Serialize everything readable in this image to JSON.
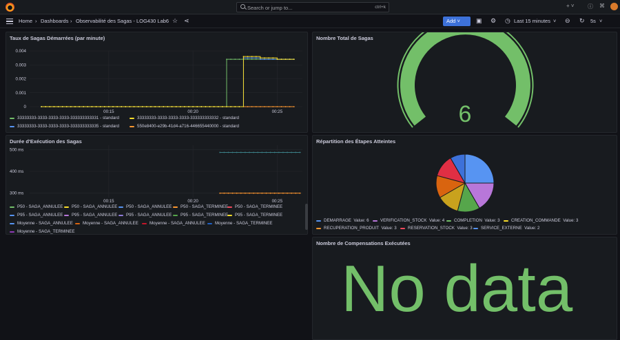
{
  "topbar": {
    "search_placeholder": "Search or jump to...",
    "search_shortcut": "ctrl+k",
    "plus_label": "+ ˅"
  },
  "navbar": {
    "home": "Home",
    "dashboards": "Dashboards",
    "dashboard_title": "Observabilité des Sagas - LOG430 Lab6",
    "add_label": "Add",
    "time_range": "Last 15 minutes",
    "refresh_interval": "5s"
  },
  "panels": {
    "rate": {
      "title": "Taux de Sagas Démarrées (par minute)",
      "legend": [
        "33333333-3333-3333-3333-333333333331 - standard",
        "33333333-3333-3333-3333-333333333332 - standard",
        "33333333-3333-3333-3333-333333333335 - standard",
        "550e8400-e29b-41d4-a716-446655440000 - standard"
      ]
    },
    "total": {
      "title": "Nombre Total de Sagas",
      "value": "6"
    },
    "duration": {
      "title": "Durée d'Exécution des Sagas",
      "legend": [
        "P50 - SAGA_ANNULEE",
        "P50 - SAGA_ANNULEE",
        "P50 - SAGA_ANNULEE",
        "P50 - SAGA_TERMINEE",
        "P50 - SAGA_TERMINEE",
        "P95 - SAGA_ANNULEE",
        "P95 - SAGA_ANNULEE",
        "P95 - SAGA_ANNULEE",
        "P95 - SAGA_TERMINEE",
        "P95 - SAGA_TERMINEE",
        "Moyenne - SAGA_ANNULEE",
        "Moyenne - SAGA_ANNULEE",
        "Moyenne - SAGA_ANNULEE",
        "Moyenne - SAGA_TERMINEE",
        "Moyenne - SAGA_TERMINEE"
      ]
    },
    "steps": {
      "title": "Répartition des Étapes Atteintes",
      "legend": [
        {
          "name": "DEMARRAGE",
          "value": "Value: 6"
        },
        {
          "name": "VERIFICATION_STOCK",
          "value": "Value: 4"
        },
        {
          "name": "COMPLETION",
          "value": "Value: 3"
        },
        {
          "name": "CREATION_COMMANDE",
          "value": "Value: 3"
        },
        {
          "name": "RECUPERATION_PRODUIT",
          "value": "Value: 3"
        },
        {
          "name": "RESERVATION_STOCK",
          "value": "Value: 3"
        },
        {
          "name": "SERVICE_EXTERNE",
          "value": "Value: 2"
        }
      ]
    },
    "compensations": {
      "title": "Nombre de Compensations Exécutées",
      "no_data": "No data"
    }
  },
  "colors": {
    "green": "#73bf69",
    "yellow": "#fade2a",
    "blue": "#5794f2",
    "orange": "#ff9830",
    "red": "#f2495c",
    "purple": "#b877d9",
    "teal": "#3b7f86",
    "dark_orange": "#d9640f",
    "olive": "#c9a21d"
  },
  "chart_data": [
    {
      "type": "line",
      "title": "Taux de Sagas Démarrées (par minute)",
      "x_ticks": [
        "00:15",
        "00:20",
        "00:25"
      ],
      "y_ticks": [
        "0",
        "0.001",
        "0.002",
        "0.003",
        "0.004"
      ],
      "ylim": [
        0,
        0.004
      ],
      "x": [
        "00:11",
        "00:12",
        "00:13",
        "00:14",
        "00:15",
        "00:16",
        "00:17",
        "00:18",
        "00:19",
        "00:20",
        "00:21",
        "00:22",
        "00:23",
        "00:24",
        "00:25",
        "00:26"
      ],
      "series": [
        {
          "name": "33333333-3333-3333-3333-333333333331 - standard",
          "values": [
            0,
            0,
            0,
            0,
            0,
            0,
            0,
            0,
            0,
            0,
            0,
            0.0034,
            0.0034,
            0.0034,
            0.0034,
            0.0034
          ]
        },
        {
          "name": "33333333-3333-3333-3333-333333333332 - standard",
          "values": [
            0,
            0,
            0,
            0,
            0,
            0,
            0,
            0,
            0,
            0,
            0,
            0,
            0.0036,
            0.0035,
            0.0034,
            0.0034
          ]
        },
        {
          "name": "33333333-3333-3333-3333-333333333335 - standard",
          "values": [
            0,
            0,
            0,
            0,
            0,
            0,
            0,
            0,
            0,
            0,
            0,
            0,
            0.0035,
            0.0034,
            0.0034,
            0.0034
          ]
        },
        {
          "name": "550e8400-e29b-41d4-a716-446655440000 - standard",
          "values": [
            0,
            0,
            0,
            0,
            0,
            0,
            0,
            0,
            0,
            0,
            0,
            0,
            0,
            0,
            0,
            0
          ]
        }
      ]
    },
    {
      "type": "line",
      "title": "Durée d'Exécution des Sagas",
      "x_ticks": [
        "00:15",
        "00:20",
        "00:25"
      ],
      "y_ticks": [
        "300 ms",
        "400 ms",
        "500 ms"
      ],
      "ylim": [
        280,
        520
      ],
      "x": [
        "00:22",
        "00:23",
        "00:24",
        "00:25",
        "00:26"
      ],
      "series": [
        {
          "name": "P95 - SAGA_TERMINEE",
          "values": [
            487,
            487,
            487,
            487,
            487
          ]
        },
        {
          "name": "P50 - SAGA_TERMINEE",
          "values": [
            300,
            300,
            300,
            300,
            300
          ]
        }
      ]
    },
    {
      "type": "pie",
      "title": "Répartition des Étapes Atteintes",
      "categories": [
        "DEMARRAGE",
        "VERIFICATION_STOCK",
        "COMPLETION",
        "CREATION_COMMANDE",
        "RECUPERATION_PRODUIT",
        "RESERVATION_STOCK",
        "SERVICE_EXTERNE"
      ],
      "values": [
        6,
        4,
        3,
        3,
        3,
        3,
        2
      ]
    },
    {
      "type": "gauge",
      "title": "Nombre Total de Sagas",
      "value": 6,
      "max": 6
    }
  ]
}
